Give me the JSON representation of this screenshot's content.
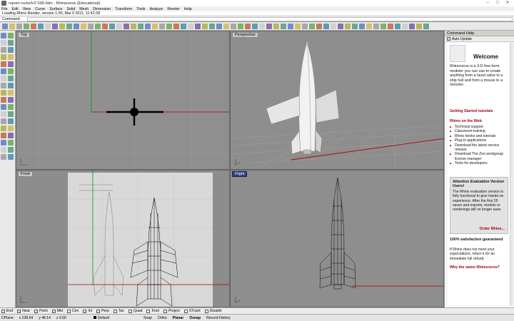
{
  "window": {
    "title": "repom rocketV2 038.3dm - Rhinoceros (Educational)"
  },
  "menu": [
    "File",
    "Edit",
    "View",
    "Curve",
    "Surface",
    "Solid",
    "Mesh",
    "Dimension",
    "Transform",
    "Tools",
    "Analyze",
    "Render",
    "Help"
  ],
  "history_text": "Loading Rhino Render, version 1.00, Mar 9 2011, 11:41:28",
  "command_prompt": "Command:",
  "viewports": {
    "top": "Top",
    "perspective": "Perspective",
    "front": "Front",
    "flight": "Flight"
  },
  "panel": {
    "header": "Command Help",
    "auto_update": "Auto-Update",
    "welcome": "Welcome",
    "intro": "Rhinoceros is a 3-D free-form modeler you can use to create anything from a heart valve to a ship hull and from a mouse to a monster.",
    "getting_started": "Getting Started tutorials",
    "rhino_web": "Rhino on the Web",
    "web_items": [
      "Technical support",
      "Classroom-training",
      "Rhino books and tutorials",
      "Plug-in applications",
      "Download the latest service release",
      "Download The Zoo workgroup license manager",
      "Tools for developers"
    ],
    "attention_title": "Attention Evaluation Version Users!",
    "attention_body": "The Rhino evaluation version is fully functional to give hands-on experience. After the first 25 saves and exports, models or renderings will no longer save.",
    "order": "Order Rhino...",
    "guarantee_title": "100% satisfaction guaranteed",
    "guarantee_body": "If Rhino does not meet your expectations, return it for an immediate full refund.",
    "why": "Why the name Rhinoceros?"
  },
  "osnaps": [
    {
      "label": "End",
      "checked": true
    },
    {
      "label": "Near",
      "checked": true
    },
    {
      "label": "Point",
      "checked": true
    },
    {
      "label": "Mid",
      "checked": true
    },
    {
      "label": "Cen",
      "checked": false
    },
    {
      "label": "Int",
      "checked": true
    },
    {
      "label": "Perp",
      "checked": true
    },
    {
      "label": "Tan",
      "checked": false
    },
    {
      "label": "Quad",
      "checked": false
    },
    {
      "label": "Knot",
      "checked": false
    },
    {
      "label": "Project",
      "checked": false
    },
    {
      "label": "STrack",
      "checked": false
    },
    {
      "label": "Disable",
      "checked": false
    }
  ],
  "status": {
    "cplane": "CPlane",
    "x": "x 238.64",
    "y": "y 48.14",
    "z": "z 0.00",
    "layer": "Default",
    "snap": "Snap",
    "ortho": "Ortho",
    "planar": "Planar",
    "osnap": "Osnap",
    "record_history": "Record History"
  },
  "colors": {
    "accent_red": "#a6001a",
    "viewport_bg": "#8f8f8f",
    "grid_red": "#b00000",
    "grid_green": "#00a000"
  }
}
